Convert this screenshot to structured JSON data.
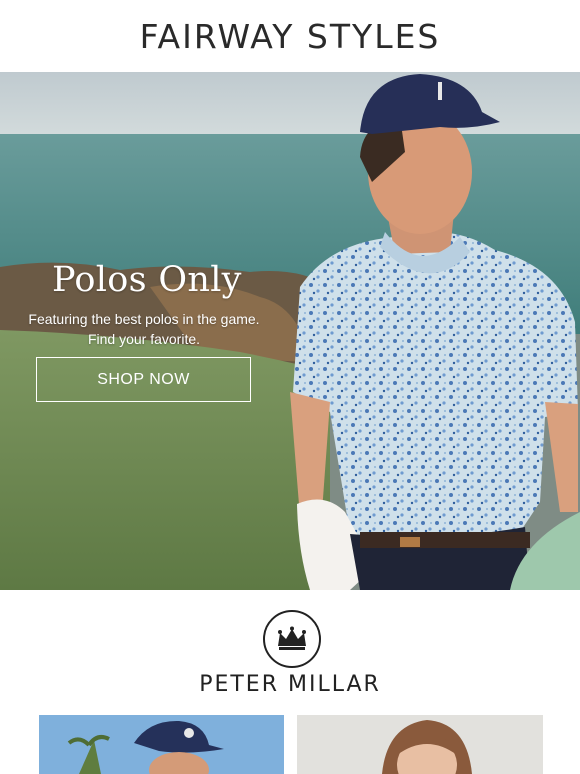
{
  "header": {
    "brand": "FAIRWAY STYLES"
  },
  "hero": {
    "title": "Polos Only",
    "subtitle_line1": "Featuring the best polos in the game.",
    "subtitle_line2": "Find your favorite.",
    "cta_label": "SHOP NOW"
  },
  "brand_section": {
    "name": "PETER  MILLAR",
    "logo_icon": "crown-icon"
  },
  "colors": {
    "hero_sky": "#c9d3d6",
    "sea": "#5e9591",
    "grass": "#71895a",
    "cap": "#24305a",
    "accent_text": "#2a2a2a"
  }
}
